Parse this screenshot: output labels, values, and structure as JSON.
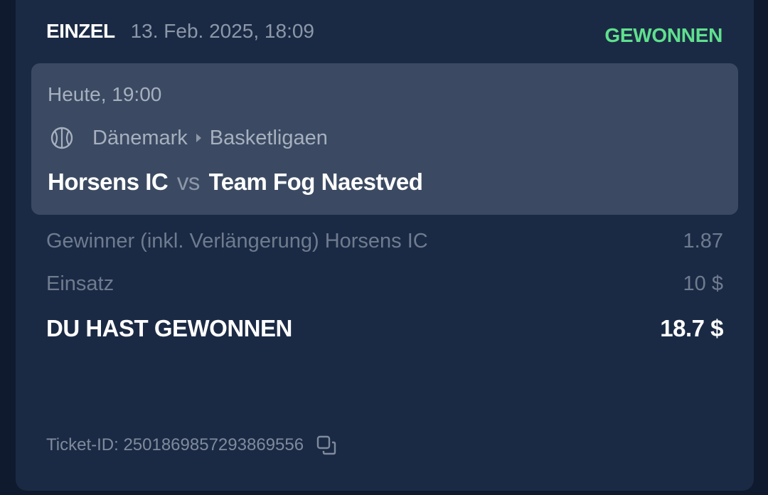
{
  "header": {
    "bet_type": "EINZEL",
    "date": "13. Feb. 2025, 18:09",
    "status": "GEWONNEN"
  },
  "event": {
    "time": "Heute, 19:00",
    "sport_icon": "basketball-icon",
    "country": "Dänemark",
    "league": "Basketligaen",
    "home_team": "Horsens IC",
    "vs": "vs",
    "away_team": "Team Fog Naestved"
  },
  "bet": {
    "market": "Gewinner (inkl. Verlängerung) Horsens IC",
    "odds": "1.87",
    "stake_label": "Einsatz",
    "stake_value": "10 $",
    "win_label": "DU HAST GEWONNEN",
    "win_value": "18.7 $"
  },
  "ticket": {
    "label": "Ticket-ID: 2501869857293869556",
    "copy_icon": "copy-icon"
  },
  "colors": {
    "card_bg": "#1b2a44",
    "event_bg": "#3b4a62",
    "status_green": "#5fe08e"
  }
}
